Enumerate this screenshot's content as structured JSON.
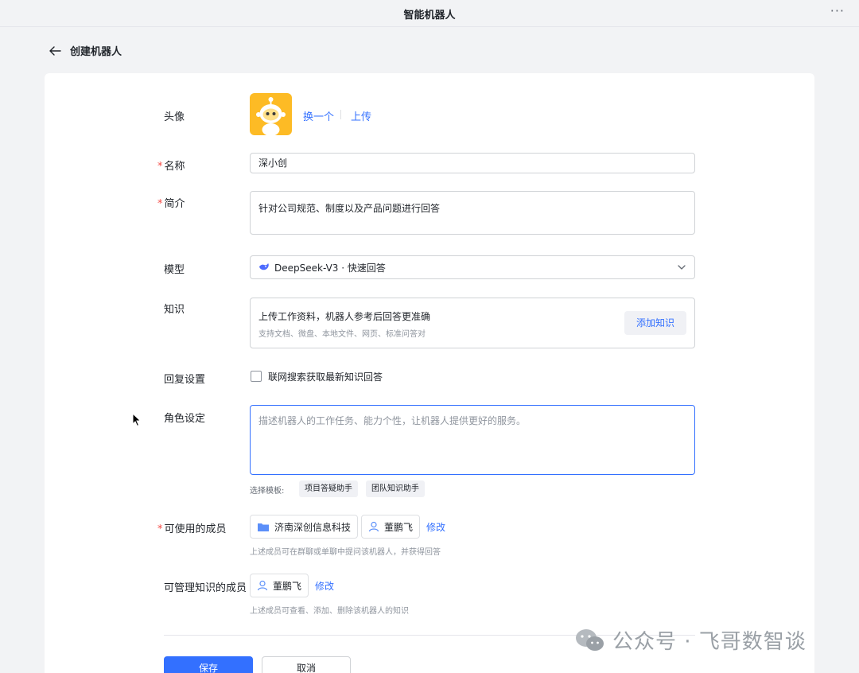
{
  "window": {
    "title": "智能机器人",
    "more_label": "···"
  },
  "page": {
    "back_title": "创建机器人"
  },
  "form": {
    "avatar": {
      "label": "头像",
      "change_label": "换一个",
      "upload_label": "上传"
    },
    "name": {
      "label": "名称",
      "required_mark": "*",
      "value": "深小创"
    },
    "intro": {
      "label": "简介",
      "required_mark": "*",
      "value": "针对公司规范、制度以及产品问题进行回答"
    },
    "model": {
      "label": "模型",
      "value": "DeepSeek-V3 · 快速回答"
    },
    "knowledge": {
      "label": "知识",
      "title": "上传工作资料，机器人参考后回答更准确",
      "subtitle": "支持文档、微盘、本地文件、网页、标准问答对",
      "add_label": "添加知识"
    },
    "reply": {
      "label": "回复设置",
      "checkbox_label": "联网搜索获取最新知识回答",
      "checked": false
    },
    "role": {
      "label": "角色设定",
      "placeholder": "描述机器人的工作任务、能力个性，让机器人提供更好的服务。",
      "template_label": "选择模板:",
      "templates": [
        "项目答疑助手",
        "团队知识助手"
      ]
    },
    "members": {
      "label": "可使用的成员",
      "required_mark": "*",
      "org": "济南深创信息科技",
      "person": "董鹏飞",
      "edit_label": "修改",
      "hint": "上述成员可在群聊或单聊中提问该机器人，并获得回答"
    },
    "managers": {
      "label": "可管理知识的成员",
      "person": "董鹏飞",
      "edit_label": "修改",
      "hint": "上述成员可查看、添加、删除该机器人的知识"
    },
    "actions": {
      "save_label": "保存",
      "cancel_label": "取消"
    }
  },
  "watermark": {
    "text": "公众号 · 飞哥数智谈"
  },
  "colors": {
    "accent": "#3370ff",
    "required": "#f54a45",
    "avatar_bg": "#fdbb25"
  }
}
